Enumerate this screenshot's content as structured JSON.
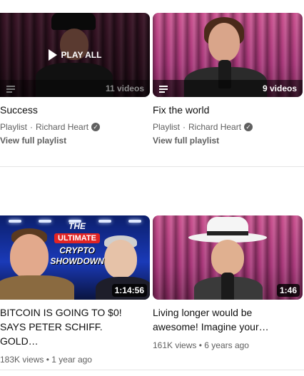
{
  "playlists": [
    {
      "title": "Success",
      "type_label": "Playlist",
      "channel": "Richard Heart",
      "count": "11 videos",
      "play_all": "PLAY ALL",
      "view_full": "View full playlist"
    },
    {
      "title": "Fix the world",
      "type_label": "Playlist",
      "channel": "Richard Heart",
      "count": "9 videos",
      "view_full": "View full playlist"
    }
  ],
  "videos": [
    {
      "title_line1": "BITCOIN IS GOING TO $0!",
      "title_line2": "SAYS PETER SCHIFF. GOLD…",
      "duration": "1:14:56",
      "views": "183K views",
      "age": "1 year ago",
      "thumb_the": "THE",
      "thumb_ultimate": "ULTIMATE",
      "thumb_crypto": "CRYPTO",
      "thumb_showdown": "SHOWDOWN"
    },
    {
      "title_line1": "Living longer would be",
      "title_line2": "awesome! Imagine your…",
      "duration": "1:46",
      "views": "161K views",
      "age": "6 years ago"
    }
  ],
  "separator": "·",
  "meta_separator": "•",
  "colors": {
    "accent": "#0f0f0f",
    "secondary_text": "#606060",
    "badge_red": "#e22424"
  }
}
